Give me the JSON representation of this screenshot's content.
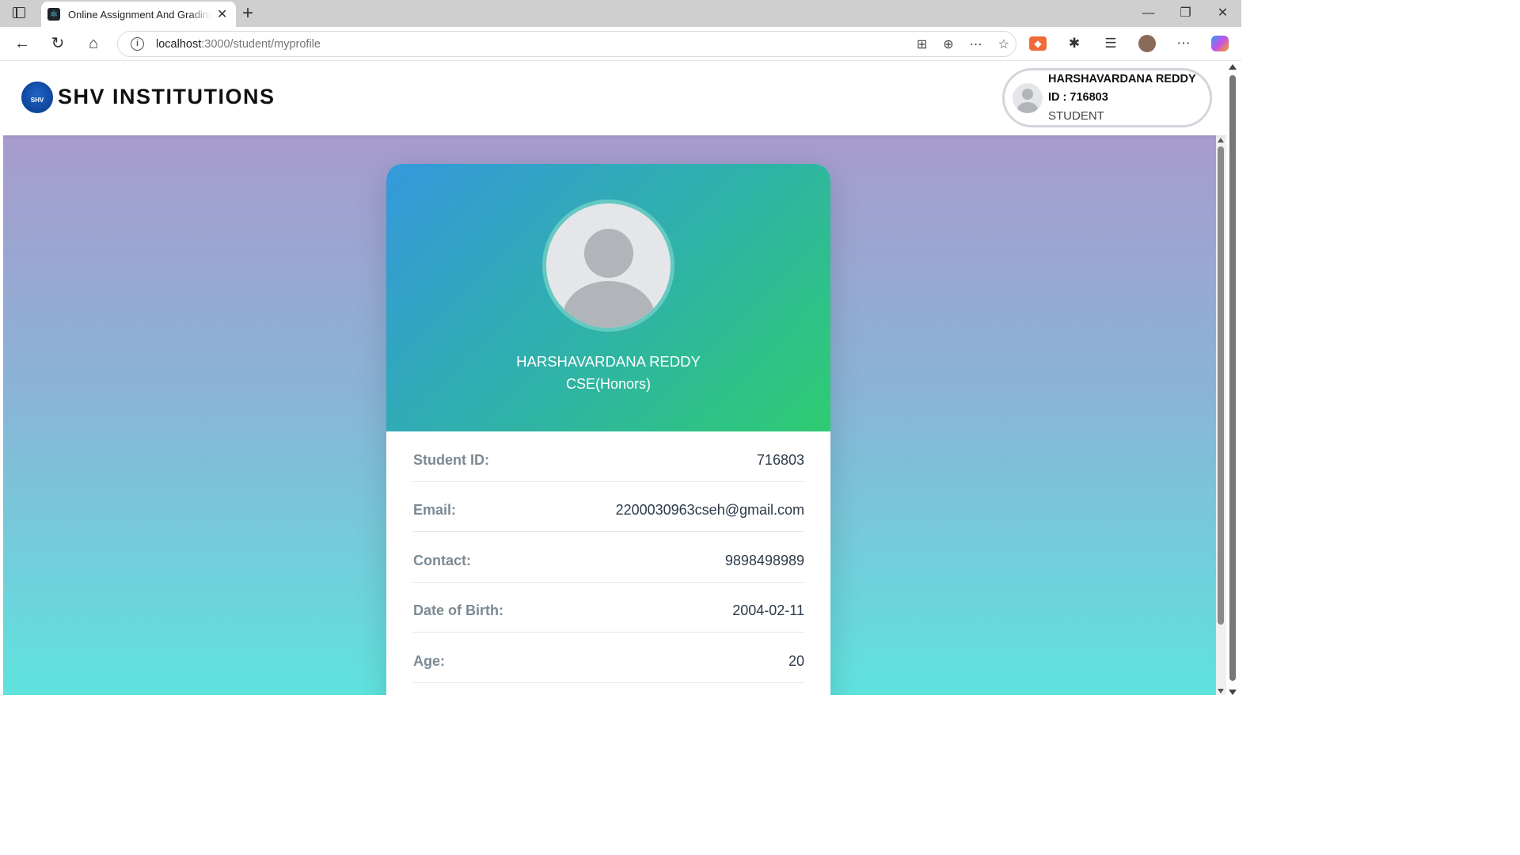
{
  "browser": {
    "tab_title": "Online Assignment And Grading System",
    "url_host": "localhost",
    "url_path": ":3000/student/myprofile"
  },
  "header": {
    "brand": "SHV INSTITUTIONS",
    "logo_text": "SHV",
    "user": {
      "name": "HARSHAVARDANA REDDY",
      "id_line": "ID : 716803",
      "role": "STUDENT"
    }
  },
  "profile": {
    "name": "HARSHAVARDANA REDDY",
    "branch": "CSE(Honors)",
    "rows": [
      {
        "label": "Student ID:",
        "value": "716803"
      },
      {
        "label": "Email:",
        "value": "2200030963cseh@gmail.com"
      },
      {
        "label": "Contact:",
        "value": "9898498989"
      },
      {
        "label": "Date of Birth:",
        "value": "2004-02-11"
      },
      {
        "label": "Age:",
        "value": "20"
      }
    ]
  },
  "colors": {
    "gradient_top": "#a89bcd",
    "gradient_bottom": "#5fe3de",
    "card_header_start": "#3598dc",
    "card_header_end": "#2ecc71"
  }
}
